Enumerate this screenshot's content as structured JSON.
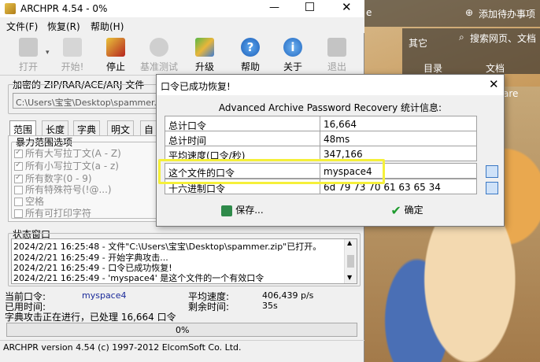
{
  "background": {
    "add_todo": "添加待办事项",
    "other": "其它",
    "search": "搜索网页、文档",
    "directory": "目录",
    "documents": "文档",
    "side_text": "are"
  },
  "window": {
    "title": "ARCHPR 4.54 - 0%",
    "menu": [
      "文件(F)",
      "恢复(R)",
      "帮助(H)"
    ],
    "toolbar": [
      "打开",
      "开始!",
      "停止",
      "基准测试",
      "升级",
      "帮助",
      "关于",
      "退出"
    ],
    "file_section_title": "加密的 ZIP/RAR/ACE/ARJ 文件",
    "file_path": "C:\\Users\\宝宝\\Desktop\\spammer.zip",
    "tabs": [
      "范围",
      "长度",
      "字典",
      "明文",
      "自"
    ],
    "brute_group_title": "暴力范围选项",
    "brute_options": [
      {
        "label": "所有大写拉丁文(A - Z)",
        "checked": true
      },
      {
        "label": "所有小写拉丁文(a - z)",
        "checked": true
      },
      {
        "label": "所有数字(0 - 9)",
        "checked": true
      },
      {
        "label": "所有特殊符号(!@...)",
        "checked": false
      },
      {
        "label": "空格",
        "checked": false
      },
      {
        "label": "所有可打印字符",
        "checked": false
      }
    ],
    "status_title": "状态窗口",
    "log_lines": [
      "2024/2/21 16:25:48 - 文件\"C:\\Users\\宝宝\\Desktop\\spammer.zip\"已打开。",
      "2024/2/21 16:25:49 - 开始字典攻击...",
      "2024/2/21 16:25:49 - 口令已成功恢复!",
      "2024/2/21 16:25:49 - 'myspace4' 是这个文件的一个有效口令"
    ],
    "current_password_label": "当前口令:",
    "current_password": "myspace4",
    "avg_speed_label": "平均速度:",
    "avg_speed": "406,439 p/s",
    "elapsed_label": "已用时间:",
    "remaining_label": "剩余时间:",
    "remaining": "35s",
    "progress_status": "字典攻击正在进行，已处理 16,664 口令",
    "progress_percent": "0%",
    "footer": "ARCHPR version 4.54 (c) 1997-2012 ElcomSoft Co. Ltd."
  },
  "dialog": {
    "title": "口令已成功恢复!",
    "header": "Advanced Archive Password Recovery 统计信息:",
    "rows": [
      {
        "label": "总计口令",
        "value": "16,664"
      },
      {
        "label": "总计时间",
        "value": "48ms"
      },
      {
        "label": "平均速度(口令/秒)",
        "value": "347,166"
      },
      {
        "label": "这个文件的口令",
        "value": "myspace4"
      },
      {
        "label": "十六进制口令",
        "value": "6d 79 73 70 61 63 65 34"
      }
    ],
    "save_label": "保存...",
    "ok_label": "确定",
    "highlight_color": "#f5f03a"
  }
}
